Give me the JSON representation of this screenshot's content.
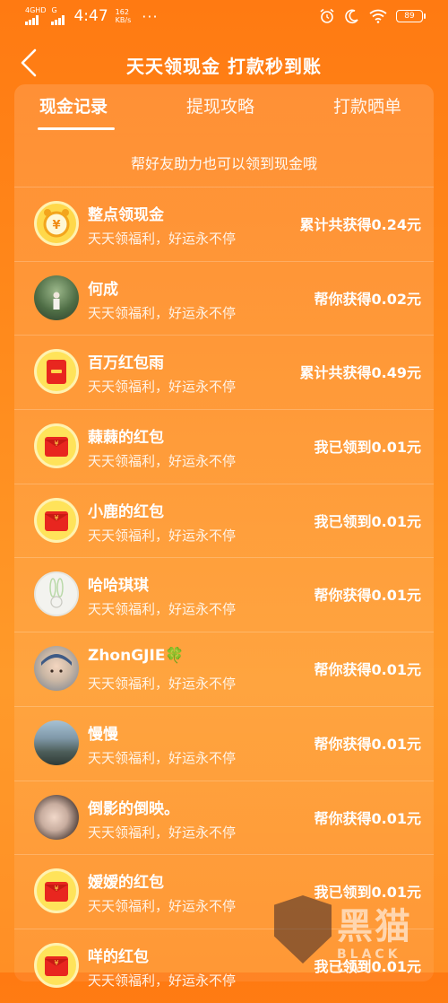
{
  "status_bar": {
    "network_type": "4G",
    "network_hd": "HD",
    "network_g": "G",
    "time": "4:47",
    "speed_value": "162",
    "speed_unit": "KB/s",
    "dots": "···",
    "battery": "89"
  },
  "header": {
    "title": "天天领现金 打款秒到账"
  },
  "tabs": [
    {
      "label": "现金记录",
      "active": true
    },
    {
      "label": "提现攻略",
      "active": false
    },
    {
      "label": "打款晒单",
      "active": false
    }
  ],
  "subtitle": "帮好友助力也可以领到现金哦",
  "records": [
    {
      "name": "整点领现金",
      "slogan": "天天领福利，好运永不停",
      "amount": "累计共获得0.24元",
      "avatar": "alarm-clock-icon"
    },
    {
      "name": "何成",
      "slogan": "天天领福利，好运永不停",
      "amount": "帮你获得0.02元",
      "avatar": "user-photo"
    },
    {
      "name": "百万红包雨",
      "slogan": "天天领福利，好运永不停",
      "amount": "累计共获得0.49元",
      "avatar": "red-packet-icon"
    },
    {
      "name": "蕀蕀的红包",
      "slogan": "天天领福利，好运永不停",
      "amount": "我已领到0.01元",
      "avatar": "red-packet-icon"
    },
    {
      "name": "小鹿的红包",
      "slogan": "天天领福利，好运永不停",
      "amount": "我已领到0.01元",
      "avatar": "red-packet-icon"
    },
    {
      "name": "哈哈琪琪",
      "slogan": "天天领福利，好运永不停",
      "amount": "帮你获得0.01元",
      "avatar": "bunny-avatar"
    },
    {
      "name": "ZhonGJIE🍀",
      "slogan": "天天领福利，好运永不停",
      "amount": "帮你获得0.01元",
      "avatar": "child-photo"
    },
    {
      "name": "慢慢",
      "slogan": "天天领福利，好运永不停",
      "amount": "帮你获得0.01元",
      "avatar": "lake-photo"
    },
    {
      "name": "倒影的倒映。",
      "slogan": "天天领福利，好运永不停",
      "amount": "帮你获得0.01元",
      "avatar": "woman-photo"
    },
    {
      "name": "嫒嫒的红包",
      "slogan": "天天领福利，好运永不停",
      "amount": "我已领到0.01元",
      "avatar": "red-packet-icon"
    },
    {
      "name": "咩的红包",
      "slogan": "天天领福利，好运永不停",
      "amount": "我已领到0.01元",
      "avatar": "red-packet-icon"
    }
  ],
  "watermark": {
    "cn": "黑猫",
    "en": "BLACK CAT"
  },
  "colors": {
    "background": "#ff8a1c",
    "text": "#ffffff",
    "packet_red": "#e8261f",
    "packet_gold": "#ffd84a"
  }
}
